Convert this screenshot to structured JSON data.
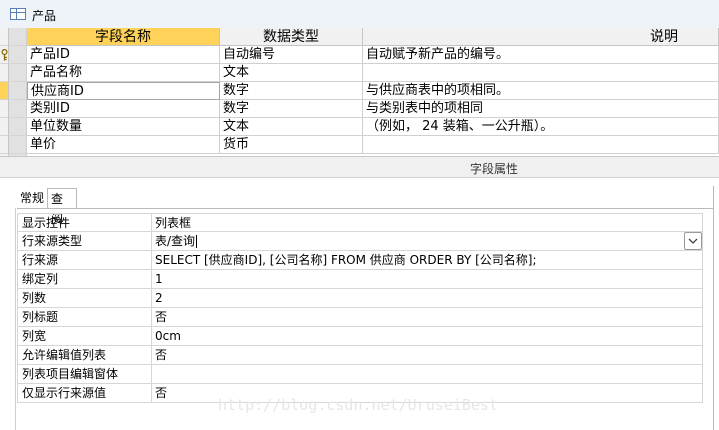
{
  "window": {
    "title": "产品",
    "icon": "table-icon"
  },
  "design_grid": {
    "headers": {
      "field_name": "字段名称",
      "data_type": "数据类型",
      "description": "说明"
    },
    "rows": [
      {
        "field": "产品ID",
        "type": "自动编号",
        "desc": "自动赋予新产品的编号。",
        "primary_key": true
      },
      {
        "field": "产品名称",
        "type": "文本",
        "desc": ""
      },
      {
        "field": "供应商ID",
        "type": "数字",
        "desc": "与供应商表中的项相同。",
        "selected": true
      },
      {
        "field": "类别ID",
        "type": "数字",
        "desc": "与类别表中的项相同"
      },
      {
        "field": "单位数量",
        "type": "文本",
        "desc": "（例如， 24 装箱、一公升瓶）。"
      },
      {
        "field": "单价",
        "type": "货币",
        "desc": ""
      }
    ]
  },
  "field_properties": {
    "title": "字段属性",
    "tabs": [
      {
        "label": "常规",
        "active": false
      },
      {
        "label": "查阅",
        "active": true
      }
    ],
    "properties": [
      {
        "label": "显示控件",
        "value": "列表框"
      },
      {
        "label": "行来源类型",
        "value": "表/查询",
        "active": true
      },
      {
        "label": "行来源",
        "value": "SELECT [供应商ID], [公司名称] FROM 供应商 ORDER BY [公司名称];"
      },
      {
        "label": "绑定列",
        "value": "1"
      },
      {
        "label": "列数",
        "value": "2"
      },
      {
        "label": "列标题",
        "value": "否"
      },
      {
        "label": "列宽",
        "value": "0cm"
      },
      {
        "label": "允许编辑值列表",
        "value": "否"
      },
      {
        "label": "列表项目编辑窗体",
        "value": ""
      },
      {
        "label": "仅显示行来源值",
        "value": "否"
      }
    ]
  },
  "watermark": "http://blog.csdn.net/UruseiBest",
  "colors": {
    "selection": "#ffd35a",
    "header_bg": "#f1f1f1",
    "grid_line": "#d0d0d0"
  }
}
